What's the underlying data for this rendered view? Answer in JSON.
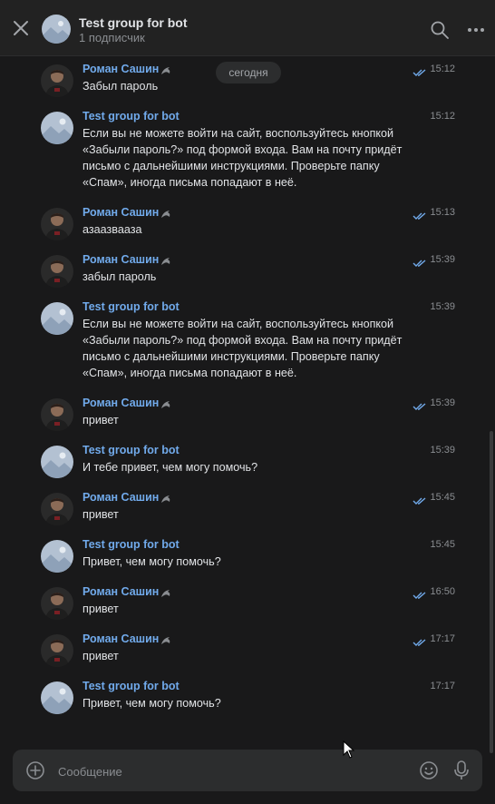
{
  "header": {
    "title": "Test group for bot",
    "subtitle": "1 подписчик",
    "close_icon": "close-icon",
    "search_icon": "search-icon",
    "more_icon": "more-icon"
  },
  "date_separator": "сегодня",
  "messages": [
    {
      "author": "Роман Сашин",
      "time": "15:12",
      "text": "Забыл пароль",
      "type": "user",
      "read": true
    },
    {
      "author": "Test group for bot",
      "time": "15:12",
      "text": "Если вы не можете войти на сайт, воспользуйтесь кнопкой «Забыли пароль?» под формой входа. Вам на почту придёт письмо с дальнейшими инструкциями. Проверьте папку «Спам», иногда письма попадают в неё.",
      "type": "bot"
    },
    {
      "author": "Роман Сашин",
      "time": "15:13",
      "text": "азаазвааза",
      "type": "user",
      "read": true
    },
    {
      "author": "Роман Сашин",
      "time": "15:39",
      "text": "забыл пароль",
      "type": "user",
      "read": true
    },
    {
      "author": "Test group for bot",
      "time": "15:39",
      "text": "Если вы не можете войти на сайт, воспользуйтесь кнопкой «Забыли пароль?» под формой входа. Вам на почту придёт письмо с дальнейшими инструкциями. Проверьте папку «Спам», иногда письма попадают в неё.",
      "type": "bot"
    },
    {
      "author": "Роман Сашин",
      "time": "15:39",
      "text": "привет",
      "type": "user",
      "read": true
    },
    {
      "author": "Test group for bot",
      "time": "15:39",
      "text": "И тебе привет, чем могу помочь?",
      "type": "bot"
    },
    {
      "author": "Роман Сашин",
      "time": "15:45",
      "text": "привет",
      "type": "user",
      "read": true
    },
    {
      "author": "Test group for bot",
      "time": "15:45",
      "text": "Привет, чем могу помочь?",
      "type": "bot"
    },
    {
      "author": "Роман Сашин",
      "time": "16:50",
      "text": "привет",
      "type": "user",
      "read": true
    },
    {
      "author": "Роман Сашин",
      "time": "17:17",
      "text": "привет",
      "type": "user",
      "read": true
    },
    {
      "author": "Test group for bot",
      "time": "17:17",
      "text": "Привет, чем могу помочь?",
      "type": "bot"
    }
  ],
  "composer": {
    "placeholder": "Сообщение",
    "attach_icon": "plus-circle-icon",
    "emoji_icon": "smile-icon",
    "mic_icon": "microphone-icon"
  },
  "colors": {
    "background": "#19191a",
    "header": "#222222",
    "accent": "#71aaeb",
    "text": "#e1e3e6",
    "muted": "#8a8d91"
  }
}
